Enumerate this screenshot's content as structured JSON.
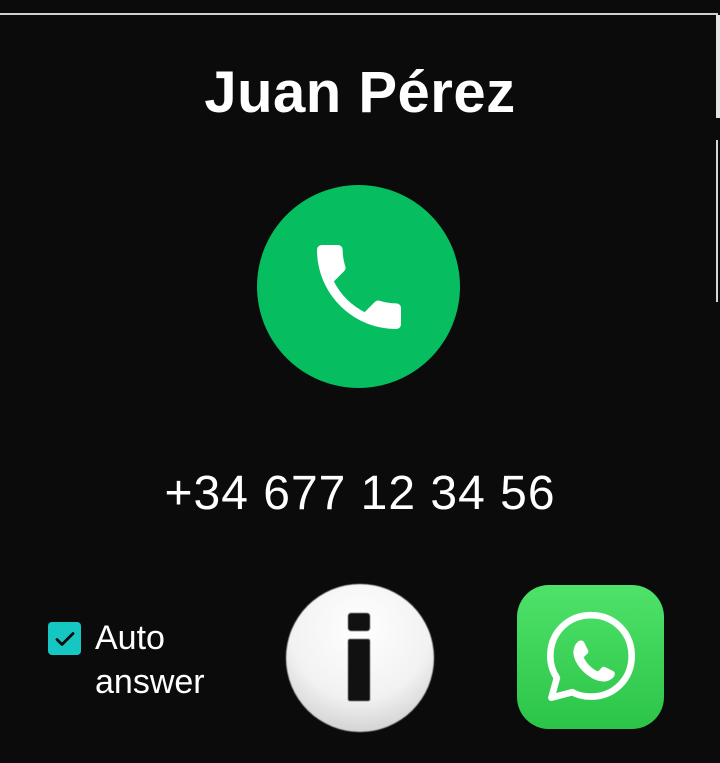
{
  "call": {
    "contact_name": "Juan Pérez",
    "phone_number": "+34 677 12 34 56",
    "auto_answer": {
      "label": "Auto answer",
      "checked": true
    }
  },
  "icons": {
    "call": "phone-icon",
    "info": "info-icon",
    "whatsapp": "whatsapp-icon",
    "checkbox": "checkmark-icon"
  },
  "colors": {
    "background": "#0b0b0b",
    "call_green": "#06bd5f",
    "checkbox_teal": "#15c6c2",
    "whatsapp_green": "#2bc448"
  }
}
